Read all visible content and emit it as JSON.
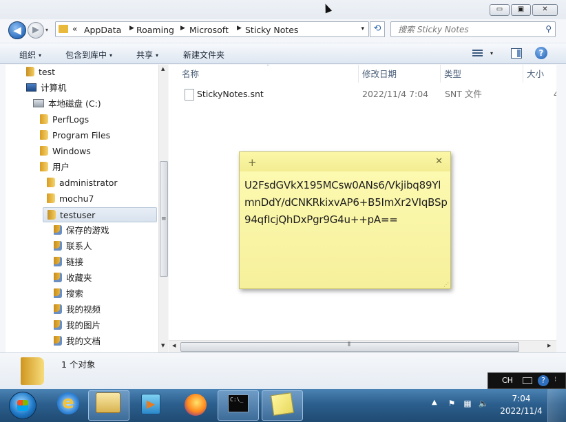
{
  "window": {
    "min_label": "▭",
    "max_label": "▣",
    "close_label": "✕"
  },
  "nav": {
    "back_glyph": "◀",
    "forward_glyph": "▶",
    "history_caret": "▾",
    "breadcrumb": [
      "AppData",
      "Roaming",
      "Microsoft",
      "Sticky Notes"
    ],
    "breadcrumb_prefix": "«",
    "address_dropdown": "▾",
    "refresh_glyph": "⟲",
    "search_placeholder": "搜索 Sticky Notes",
    "search_icon": "magnifier-icon"
  },
  "toolbar": {
    "organize": "组织",
    "include_in_library": "包含到库中",
    "share": "共享",
    "new_folder": "新建文件夹",
    "caret": "▾",
    "help": "?"
  },
  "tree": {
    "items": [
      {
        "label": "test"
      },
      {
        "label": "计算机"
      },
      {
        "label": "本地磁盘 (C:)"
      },
      {
        "label": "PerfLogs"
      },
      {
        "label": "Program Files"
      },
      {
        "label": "Windows"
      },
      {
        "label": "用户"
      },
      {
        "label": "administrator"
      },
      {
        "label": "mochu7"
      },
      {
        "label": "testuser"
      },
      {
        "label": "保存的游戏"
      },
      {
        "label": "联系人"
      },
      {
        "label": "链接"
      },
      {
        "label": "收藏夹"
      },
      {
        "label": "搜索"
      },
      {
        "label": "我的视频"
      },
      {
        "label": "我的图片"
      },
      {
        "label": "我的文档"
      }
    ]
  },
  "columns": {
    "name": "名称",
    "modified": "修改日期",
    "type": "类型",
    "size": "大小"
  },
  "files": [
    {
      "name": "StickyNotes.snt",
      "modified": "2022/11/4 7:04",
      "type": "SNT 文件",
      "size": "4"
    }
  ],
  "details": {
    "count": "1 个对象"
  },
  "sticky": {
    "add": "+",
    "close": "✕",
    "text": "U2FsdGVkX195MCsw0ANs6/Vkjibq89YlmnDdY/dCNKRkixvAP6+B5ImXr2VIqBSp94qfIcjQhDxPgr9G4u++pA=="
  },
  "langbar": {
    "lang": "CH",
    "help": "?",
    "more": "⁝"
  },
  "taskbar": {
    "time": "7:04",
    "date": "2022/11/4",
    "tray_caret": "▲"
  },
  "colors": {
    "sticky_bg": "#fdfbb4",
    "taskbar": "#2c5f8e",
    "selection": "#d8e2ee"
  }
}
